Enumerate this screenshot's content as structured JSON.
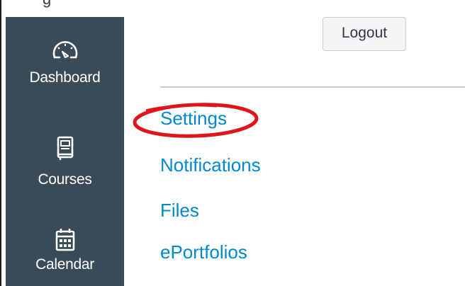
{
  "header": {
    "partial_text": "g",
    "logout_label": "Logout"
  },
  "sidebar": {
    "items": [
      {
        "label": "Dashboard",
        "icon": "dashboard-icon"
      },
      {
        "label": "Courses",
        "icon": "book-icon"
      },
      {
        "label": "Calendar",
        "icon": "calendar-icon"
      }
    ]
  },
  "account_menu": {
    "links": [
      {
        "label": "Settings"
      },
      {
        "label": "Notifications"
      },
      {
        "label": "Files"
      },
      {
        "label": "ePortfolios"
      }
    ]
  },
  "colors": {
    "sidebar_bg": "#394b58",
    "link": "#0088cc",
    "annotation": "#e0151b"
  }
}
